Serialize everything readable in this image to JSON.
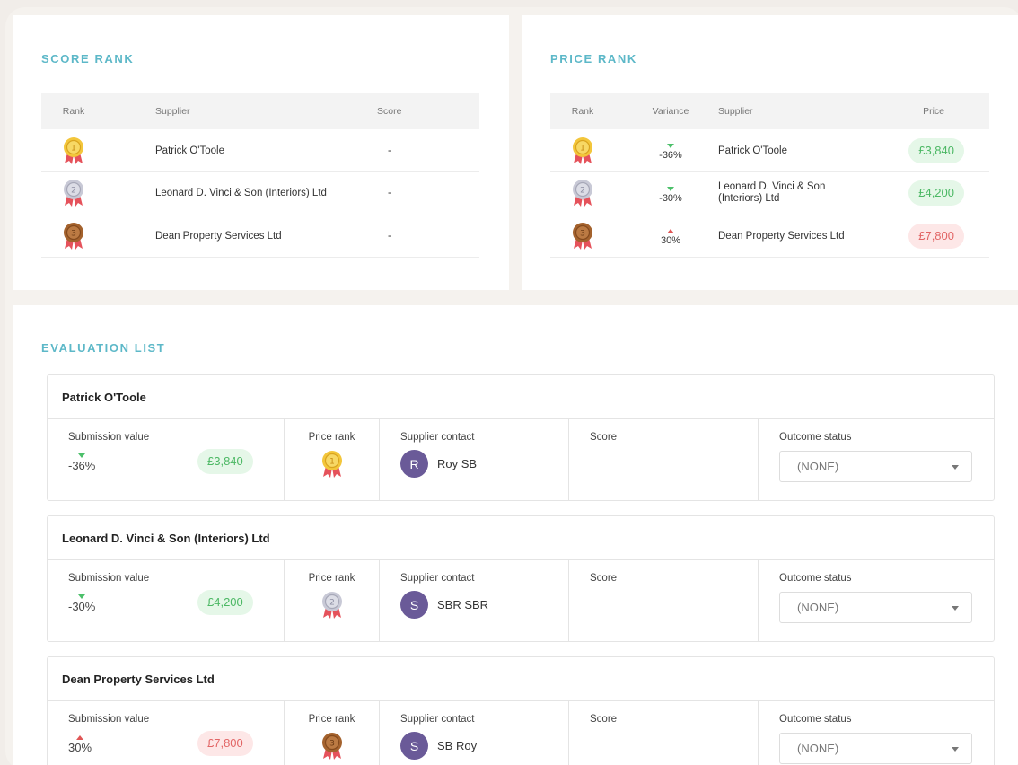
{
  "score_rank": {
    "title": "SCORE RANK",
    "headers": {
      "rank": "Rank",
      "supplier": "Supplier",
      "score": "Score"
    },
    "rows": [
      {
        "medal": "gold",
        "supplier": "Patrick O'Toole",
        "score": "-"
      },
      {
        "medal": "silver",
        "supplier": "Leonard D. Vinci & Son (Interiors) Ltd",
        "score": "-"
      },
      {
        "medal": "bronze",
        "supplier": "Dean Property Services Ltd",
        "score": "-"
      }
    ]
  },
  "price_rank": {
    "title": "PRICE RANK",
    "headers": {
      "rank": "Rank",
      "variance": "Variance",
      "supplier": "Supplier",
      "price": "Price"
    },
    "rows": [
      {
        "medal": "gold",
        "variance": "-36%",
        "trend": "down",
        "supplier": "Patrick O'Toole",
        "price": "£3,840",
        "status": "green"
      },
      {
        "medal": "silver",
        "variance": "-30%",
        "trend": "down",
        "supplier": "Leonard D. Vinci & Son (Interiors) Ltd",
        "price": "£4,200",
        "status": "green"
      },
      {
        "medal": "bronze",
        "variance": "30%",
        "trend": "up",
        "supplier": "Dean Property Services Ltd",
        "price": "£7,800",
        "status": "red"
      }
    ]
  },
  "evaluation": {
    "title": "EVALUATION LIST",
    "labels": {
      "submission": "Submission value",
      "price_rank": "Price rank",
      "contact": "Supplier contact",
      "score": "Score",
      "outcome": "Outcome status"
    },
    "items": [
      {
        "name": "Patrick O'Toole",
        "variance": "-36%",
        "trend": "down",
        "price": "£3,840",
        "status": "green",
        "medal": "gold",
        "avatar": "R",
        "contact": "Roy SB",
        "outcome": "(NONE)"
      },
      {
        "name": "Leonard D. Vinci & Son (Interiors) Ltd",
        "variance": "-30%",
        "trend": "down",
        "price": "£4,200",
        "status": "green",
        "medal": "silver",
        "avatar": "S",
        "contact": "SBR SBR",
        "outcome": "(NONE)"
      },
      {
        "name": "Dean Property Services Ltd",
        "variance": "30%",
        "trend": "up",
        "price": "£7,800",
        "status": "red",
        "medal": "bronze",
        "avatar": "S",
        "contact": "SB Roy",
        "outcome": "(NONE)"
      }
    ]
  },
  "colors": {
    "accent": "#5db8c8",
    "positive": "#4cb864",
    "negative": "#e26565",
    "avatar": "#6a5a98"
  }
}
